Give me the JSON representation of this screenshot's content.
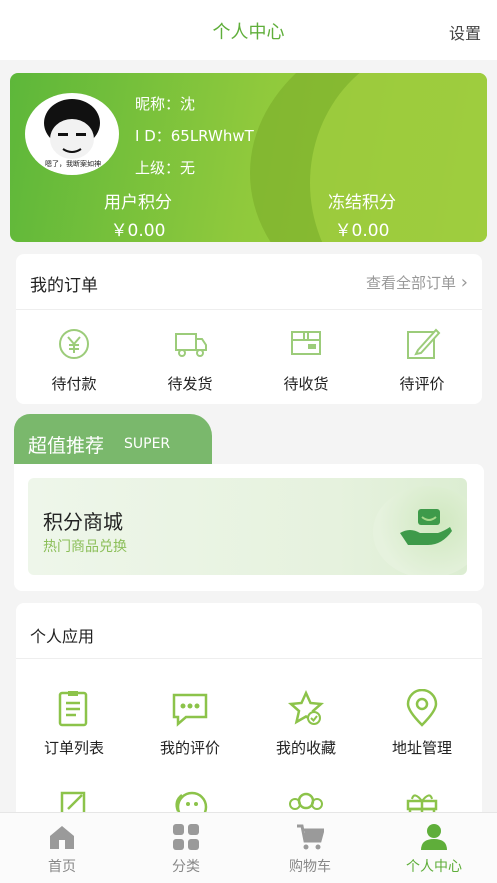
{
  "header": {
    "title": "个人中心",
    "settings": "设置"
  },
  "profile": {
    "nickname_label": "昵称：沈",
    "id_label": "I D：65LRWhwT",
    "parent_label": "上级：无",
    "avatar_caption": "嗯了，我断案如神",
    "user_points": {
      "label": "用户积分",
      "value": "￥0.00"
    },
    "frozen_points": {
      "label": "冻结积分",
      "value": "￥0.00"
    }
  },
  "orders": {
    "title": "我的订单",
    "view_all": "查看全部订单",
    "items": [
      {
        "label": "待付款",
        "icon": "yen-wallet-icon"
      },
      {
        "label": "待发货",
        "icon": "delivery-truck-icon"
      },
      {
        "label": "待收货",
        "icon": "package-box-icon"
      },
      {
        "label": "待评价",
        "icon": "edit-review-icon"
      }
    ]
  },
  "super": {
    "title": "超值推荐",
    "tag": "SUPER",
    "mall_title": "积分商城",
    "mall_subtitle": "热门商品兑换"
  },
  "apps": {
    "title": "个人应用",
    "items": [
      {
        "label": "订单列表",
        "icon": "order-list-icon"
      },
      {
        "label": "我的评价",
        "icon": "comment-icon"
      },
      {
        "label": "我的收藏",
        "icon": "star-favorite-icon"
      },
      {
        "label": "地址管理",
        "icon": "location-pin-icon"
      },
      {
        "label": "",
        "icon": "edit-note-icon"
      },
      {
        "label": "",
        "icon": "chat-face-icon"
      },
      {
        "label": "",
        "icon": "team-icon"
      },
      {
        "label": "",
        "icon": "gift-icon"
      }
    ]
  },
  "tabbar": {
    "items": [
      {
        "label": "首页",
        "icon": "home-icon"
      },
      {
        "label": "分类",
        "icon": "category-grid-icon"
      },
      {
        "label": "购物车",
        "icon": "cart-icon"
      },
      {
        "label": "个人中心",
        "icon": "user-icon"
      }
    ],
    "active_index": 3
  },
  "colors": {
    "accent": "#5fae3a",
    "icon_green": "#8cc34a",
    "inactive": "#888888"
  }
}
